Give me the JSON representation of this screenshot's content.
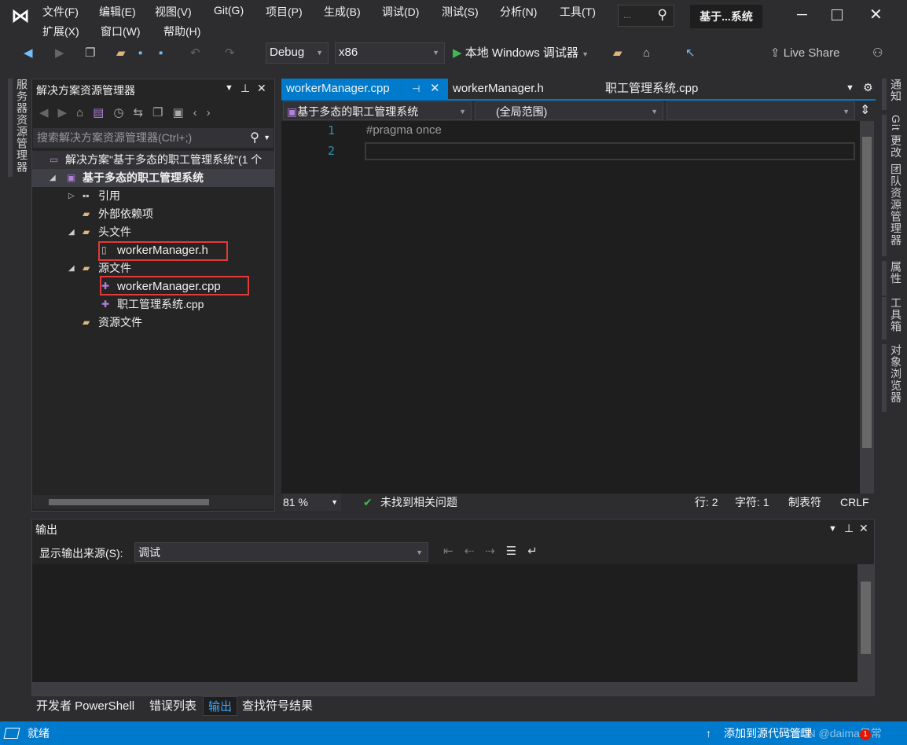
{
  "menu": {
    "row1": [
      "文件(F)",
      "编辑(E)",
      "视图(V)",
      "Git(G)",
      "项目(P)",
      "生成(B)",
      "调试(D)",
      "测试(S)",
      "分析(N)",
      "工具(T)"
    ],
    "row2": [
      "扩展(X)",
      "窗口(W)",
      "帮助(H)"
    ],
    "search_placeholder": "...",
    "window_title": "基于...系统"
  },
  "toolbar": {
    "config": "Debug",
    "platform": "x86",
    "run_label": "本地 Windows 调试器",
    "live_share": "Live Share"
  },
  "left_strip": {
    "label": "服务器资源管理器"
  },
  "solution_explorer": {
    "title": "解决方案资源管理器",
    "search_placeholder": "搜索解决方案资源管理器(Ctrl+;)",
    "items": [
      {
        "label": "解决方案\"基于多态的职工管理系统\"(1 个",
        "icon": "solution-icon"
      },
      {
        "label": "基于多态的职工管理系统",
        "icon": "project-icon",
        "expander": "◢"
      },
      {
        "label": "引用",
        "icon": "references-icon",
        "expander": "▷"
      },
      {
        "label": "外部依赖项",
        "icon": "folder-icon"
      },
      {
        "label": "头文件",
        "icon": "filter-folder-icon",
        "expander": "◢"
      },
      {
        "label": "workerManager.h",
        "icon": "header-file-icon"
      },
      {
        "label": "源文件",
        "icon": "filter-folder-icon",
        "expander": "◢"
      },
      {
        "label": "workerManager.cpp",
        "icon": "cpp-file-icon"
      },
      {
        "label": "职工管理系统.cpp",
        "icon": "cpp-file-icon"
      },
      {
        "label": "资源文件",
        "icon": "filter-folder-icon"
      }
    ]
  },
  "editor": {
    "tabs": [
      {
        "label": "workerManager.cpp",
        "active": true
      },
      {
        "label": "workerManager.h"
      },
      {
        "label": "职工管理系统.cpp"
      }
    ],
    "nav": {
      "project": "基于多态的职工管理系统",
      "scope": "(全局范围)",
      "member": ""
    },
    "lines": [
      {
        "n": "1",
        "text": "#pragma once"
      },
      {
        "n": "2",
        "text": ""
      }
    ],
    "status": {
      "zoom": "81 %",
      "issues": "未找到相关问题",
      "line": "行: 2",
      "char": "字符: 1",
      "tabs": "制表符",
      "eol": "CRLF"
    }
  },
  "right_strip": [
    "通知",
    "Git 更改",
    "团队资源管理器",
    "属性",
    "工具箱",
    "对象浏览器"
  ],
  "output": {
    "title": "输出",
    "source_label": "显示输出来源(S):",
    "source_value": "调试"
  },
  "bottom_tabs": [
    {
      "label": "开发者 PowerShell"
    },
    {
      "label": "错误列表"
    },
    {
      "label": "输出",
      "active": true
    },
    {
      "label": "查找符号结果"
    }
  ],
  "statusbar": {
    "ready": "就绪",
    "source_control": "添加到源代码管理",
    "notifications": "1",
    "watermark": "CSDN @daima日常"
  },
  "colors": {
    "accent": "#007acc",
    "highlight_box": "#e03a3a",
    "bg": "#2d2d30",
    "editor_bg": "#1e1e1e"
  }
}
